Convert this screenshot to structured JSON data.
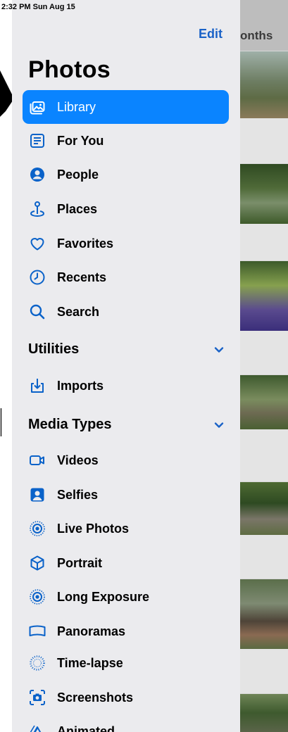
{
  "status_bar": {
    "time_date": "2:32 PM  Sun Aug 15"
  },
  "header": {
    "edit_label": "Edit",
    "title": "Photos"
  },
  "nav": [
    {
      "label": "Library",
      "icon": "photo-library-icon",
      "selected": true
    },
    {
      "label": "For You",
      "icon": "for-you-icon"
    },
    {
      "label": "People",
      "icon": "person-circle-icon"
    },
    {
      "label": "Places",
      "icon": "map-pin-icon"
    },
    {
      "label": "Favorites",
      "icon": "heart-icon"
    },
    {
      "label": "Recents",
      "icon": "clock-icon"
    },
    {
      "label": "Search",
      "icon": "search-icon"
    }
  ],
  "utilities": {
    "title": "Utilities",
    "items": [
      {
        "label": "Imports",
        "icon": "import-icon"
      }
    ]
  },
  "media_types": {
    "title": "Media Types",
    "items": [
      {
        "label": "Videos",
        "icon": "video-icon"
      },
      {
        "label": "Selfies",
        "icon": "selfie-icon"
      },
      {
        "label": "Live Photos",
        "icon": "live-photo-icon"
      },
      {
        "label": "Portrait",
        "icon": "portrait-cube-icon"
      },
      {
        "label": "Long Exposure",
        "icon": "long-exposure-icon"
      },
      {
        "label": "Panoramas",
        "icon": "panorama-icon"
      },
      {
        "label": "Time-lapse",
        "icon": "timelapse-icon"
      },
      {
        "label": "Screenshots",
        "icon": "screenshot-icon"
      },
      {
        "label": "Animated",
        "icon": "animated-icon"
      }
    ]
  },
  "photo_strip": {
    "header_label": "onths"
  },
  "colors": {
    "accent": "#0a84ff",
    "link": "#1a62c7",
    "sidebar_bg": "#ebebee"
  }
}
